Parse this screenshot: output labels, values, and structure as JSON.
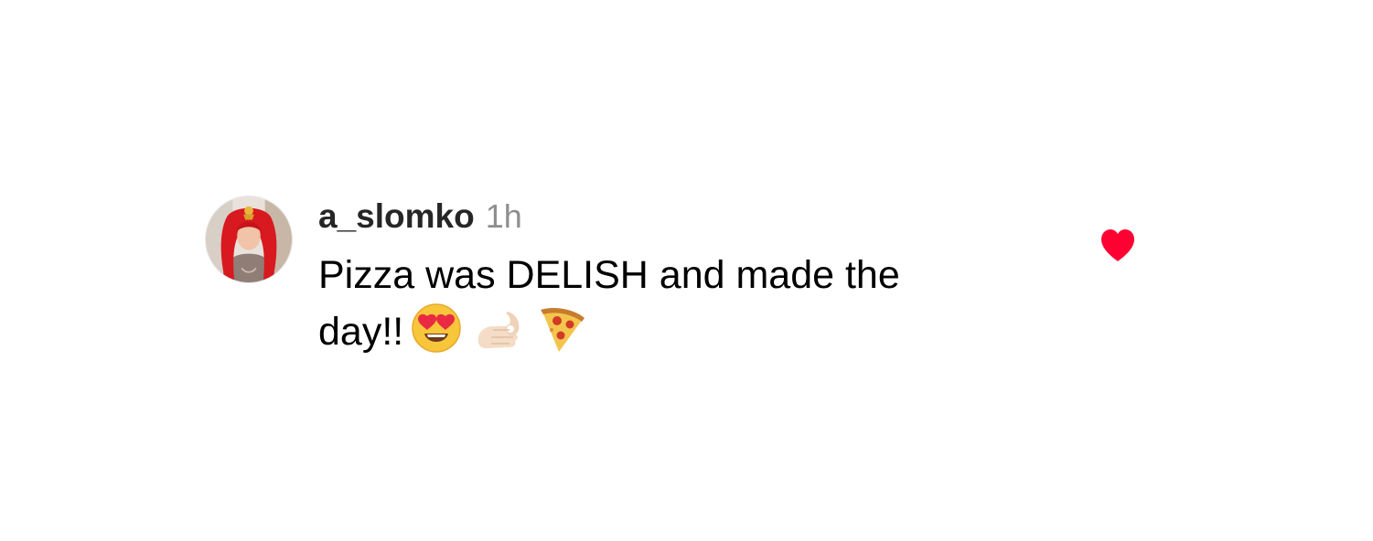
{
  "comment": {
    "username": "a_slomko",
    "timestamp": "1h",
    "text_line1": "Pizza was DELISH and made the",
    "text_line2": "day!!",
    "emojis": [
      "heart-eyes-emoji",
      "ok-hand-emoji",
      "pizza-emoji"
    ],
    "liked": true
  },
  "colors": {
    "username": "#262626",
    "timestamp": "#8e8e8e",
    "like_heart": "#ff0033"
  },
  "icons": {
    "avatar": "profile-photo-avatar",
    "like": "filled-heart-icon"
  }
}
